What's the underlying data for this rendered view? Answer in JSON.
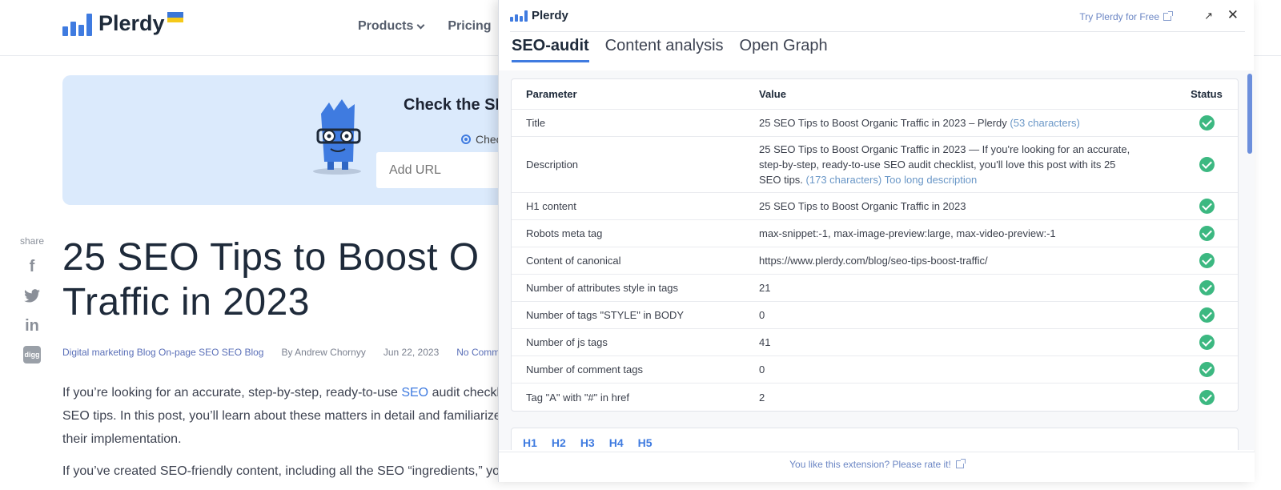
{
  "site": {
    "brand": "Plerdy",
    "nav": {
      "products": "Products",
      "pricing": "Pricing"
    },
    "banner": {
      "title": "Check the SE",
      "radio_label": "Chec",
      "url_placeholder": "Add URL"
    },
    "share": {
      "label": "share",
      "items": [
        {
          "icon": "facebook-icon",
          "glyph": "f"
        },
        {
          "icon": "twitter-icon",
          "glyph": "🐦"
        },
        {
          "icon": "linkedin-icon",
          "glyph": "in"
        },
        {
          "icon": "digg-icon",
          "glyph": "digg"
        }
      ]
    },
    "article": {
      "title_line1": "25 SEO Tips to Boost O",
      "title_line2": "Traffic in 2023",
      "meta": {
        "categories": "Digital marketing Blog On-page SEO SEO Blog",
        "author": "By Andrew Chornyy",
        "date": "Jun 22, 2023",
        "comments": "No Comm"
      },
      "p1_line1_pre": "If you’re looking for an accurate, step-by-step, ready-to-use ",
      "p1_line1_link": "SEO",
      "p1_line1_post": " audit checklis",
      "p1_line2": "SEO tips. In this post, you’ll learn about these matters in detail and familiarize",
      "p1_line3": "their implementation.",
      "p2_line1": "If you’ve created SEO-friendly content, including all the SEO “ingredients,” yo"
    }
  },
  "extension": {
    "brand": "Plerdy",
    "try_link": "Try Plerdy for Free",
    "tabs": [
      "SEO-audit",
      "Content analysis",
      "Open Graph"
    ],
    "table": {
      "headers": {
        "parameter": "Parameter",
        "value": "Value",
        "status": "Status"
      },
      "rows": [
        {
          "param": "Title",
          "value": "25 SEO Tips to Boost Organic Traffic in 2023 – Plerdy",
          "note": "(53 characters)",
          "status": "ok"
        },
        {
          "param": "Description",
          "value": "25 SEO Tips to Boost Organic Traffic in 2023 — If you're looking for an accurate, step-by-step, ready-to-use SEO audit checklist, you'll love this post with its 25 SEO tips.",
          "note": "(173 characters) Too long description",
          "status": "ok"
        },
        {
          "param": "H1 content",
          "value": "25 SEO Tips to Boost Organic Traffic in 2023",
          "note": "",
          "status": "ok"
        },
        {
          "param": "Robots meta tag",
          "value": "max-snippet:-1, max-image-preview:large, max-video-preview:-1",
          "note": "",
          "status": "ok"
        },
        {
          "param": "Content of canonical",
          "value": "https://www.plerdy.com/blog/seo-tips-boost-traffic/",
          "note": "",
          "status": "ok"
        },
        {
          "param": "Number of attributes style in tags",
          "value": "21",
          "note": "",
          "status": "ok"
        },
        {
          "param": "Number of tags \"STYLE\" in BODY",
          "value": "0",
          "note": "",
          "status": "ok"
        },
        {
          "param": "Number of js tags",
          "value": "41",
          "note": "",
          "status": "ok"
        },
        {
          "param": "Number of comment tags",
          "value": "0",
          "note": "",
          "status": "ok"
        },
        {
          "param": "Tag \"A\" with \"#\" in href",
          "value": "2",
          "note": "",
          "status": "ok"
        }
      ]
    },
    "heading_tabs": [
      "H1",
      "H2",
      "H3",
      "H4",
      "H5"
    ],
    "footer": "You like this extension? Please rate it!",
    "colors": {
      "accent": "#3f7be0",
      "ok": "#3cb881",
      "link": "#6b86c4"
    }
  }
}
